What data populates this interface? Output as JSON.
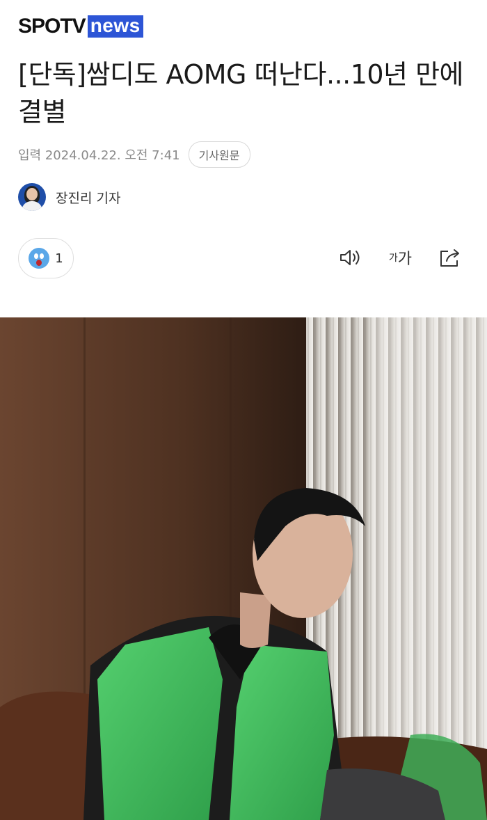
{
  "header": {
    "logo_spo": "SPOTV",
    "logo_news": "news"
  },
  "article": {
    "headline": "[단독]쌈디도 AOMG 떠난다...10년 만에 결별",
    "date": "입력 2024.04.22. 오전 7:41",
    "original_button": "기사원문",
    "reporter": "장진리 기자"
  },
  "toolbar": {
    "reaction_count": "1",
    "font_small": "가",
    "font_large": "가",
    "icons": [
      "speaker-icon",
      "font-size-icon",
      "share-icon"
    ]
  },
  "colors": {
    "brand_blue": "#2d55d6",
    "vest_green": "#3fbf5f",
    "wall_brown": "#5a3a26"
  }
}
